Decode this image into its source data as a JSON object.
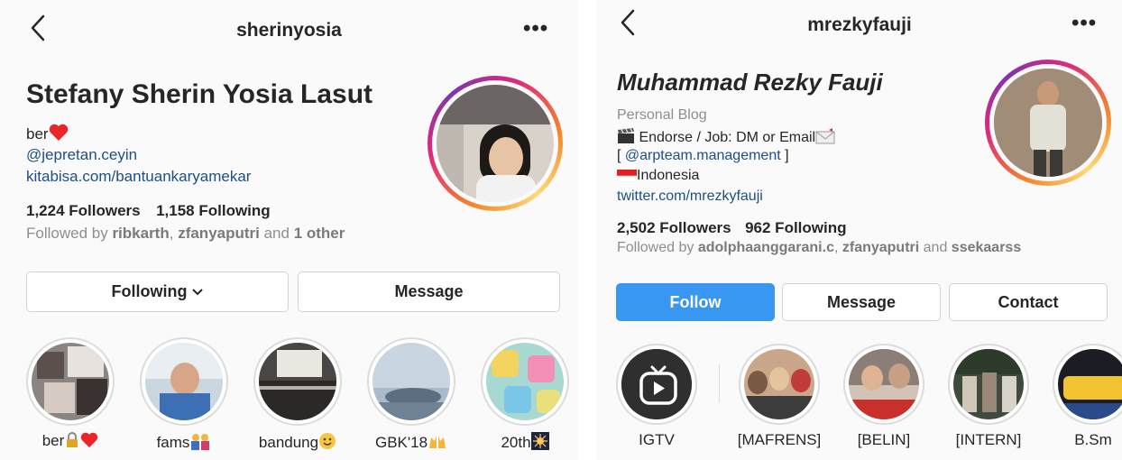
{
  "left_profile": {
    "username": "sherinyosia",
    "more_label": "•••",
    "full_name": "Stefany Sherin Yosia Lasut",
    "bio_line1": "ber",
    "mention": "@jepretan.ceyin",
    "link": "kitabisa.com/bantuankaryamekar",
    "followers": "1,224 Followers",
    "following": "1,158 Following",
    "followed_prefix": "Followed by ",
    "followed_user1": "ribkarth",
    "followed_sep": ", ",
    "followed_user2": "zfanyaputri",
    "followed_and": " and ",
    "followed_other": "1 other",
    "buttons": {
      "following": "Following",
      "message": "Message"
    },
    "highlights": [
      {
        "label": "ber"
      },
      {
        "label": "fams"
      },
      {
        "label": "bandung"
      },
      {
        "label": "GBK'18"
      },
      {
        "label": "20th"
      }
    ]
  },
  "right_profile": {
    "username": "mrezkyfauji",
    "more_label": "•••",
    "full_name": "Muhammad Rezky Fauji",
    "category": "Personal Blog",
    "bio_line1": "Endorse / Job: DM or Email",
    "bio_line2_open": "[ ",
    "bio_mention": "@arpteam.management",
    "bio_line2_close": " ]",
    "bio_line3": "Indonesia",
    "link": "twitter.com/mrezkyfauji",
    "followers": "2,502 Followers",
    "following": "962 Following",
    "followed_prefix": "Followed by ",
    "followed_user1": "adolphaanggarani.c",
    "followed_sep": ", ",
    "followed_user2": "zfanyaputri",
    "followed_and": " and ",
    "followed_user3": "ssekaarss",
    "buttons": {
      "follow": "Follow",
      "message": "Message",
      "contact": "Contact"
    },
    "highlights": [
      {
        "label": "IGTV"
      },
      {
        "label": "[MAFRENS]"
      },
      {
        "label": "[BELIN]"
      },
      {
        "label": "[INTERN]"
      },
      {
        "label": "B.Sm"
      }
    ]
  },
  "colors": {
    "link": "#1d4f85",
    "follow_button": "#3897f0",
    "story_ring_start": "#f58529",
    "story_ring_end": "#8134af"
  }
}
